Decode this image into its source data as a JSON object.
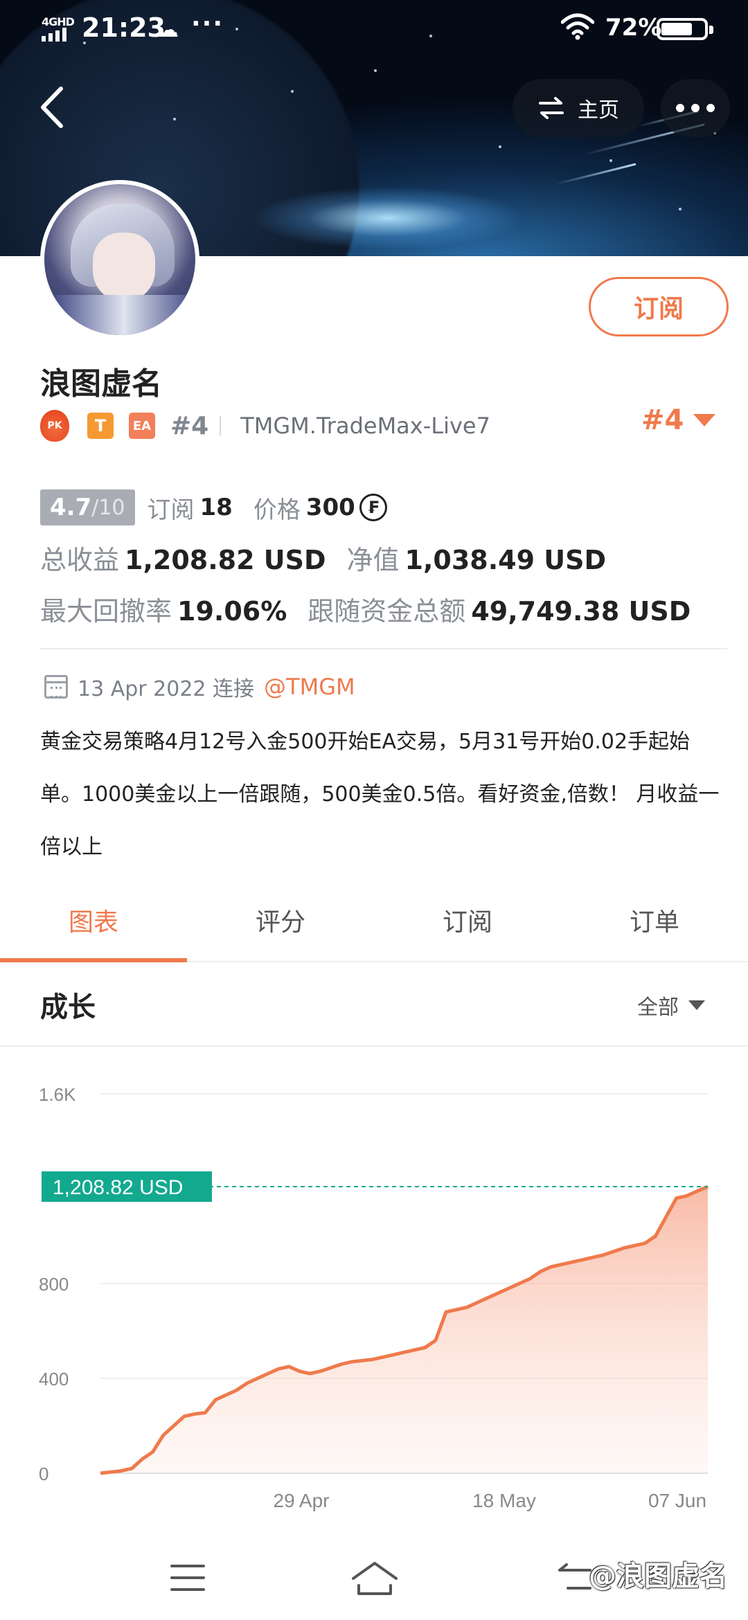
{
  "status_bar": {
    "network": "4GHD",
    "time": "21:23",
    "dots": "···",
    "battery_percent": "72%",
    "battery_level": 0.72
  },
  "header": {
    "home_label": "主页"
  },
  "profile": {
    "name": "浪图虚名",
    "subscribe_label": "订阅",
    "badge_pk": "PK",
    "badge_t": "T",
    "badge_ea": "EA",
    "rank": "#4",
    "broker": "TMGM.TradeMax-Live7",
    "rank_selector": "#4"
  },
  "stats": {
    "score": "4.7",
    "score_max": "/10",
    "subscribe_label": "订阅",
    "subscribe_count": "18",
    "price_label": "价格",
    "price_value": "300",
    "coin_symbol": "₣",
    "total_profit_label": "总收益",
    "total_profit_value": "1,208.82 USD",
    "net_value_label": "净值",
    "net_value_value": "1,038.49 USD",
    "max_drawdown_label": "最大回撤率",
    "max_drawdown_value": "19.06%",
    "follow_funds_label": "跟随资金总额",
    "follow_funds_value": "49,749.38 USD"
  },
  "connection": {
    "date": "13 Apr 2022 连接",
    "mention": "@TMGM"
  },
  "description": "黄金交易策略4月12号入金500开始EA交易，5月31号开始0.02手起始单。1000美金以上一倍跟随，500美金0.5倍。看好资金,倍数！ 月收益一倍以上",
  "tabs": [
    {
      "label": "图表",
      "active": true
    },
    {
      "label": "评分",
      "active": false
    },
    {
      "label": "订阅",
      "active": false
    },
    {
      "label": "订单",
      "active": false
    }
  ],
  "growth": {
    "title": "成长",
    "range": "全部"
  },
  "chart_data": {
    "type": "area",
    "y_ticks": [
      "0",
      "400",
      "800",
      "1.6K"
    ],
    "y_tick_values": [
      0,
      400,
      800,
      1600
    ],
    "ylim": [
      0,
      1600
    ],
    "x_ticks": [
      "29 Apr",
      "18 May",
      "07 Jun"
    ],
    "current_label": "1,208.82 USD",
    "current_value": 1208.82,
    "color": "#ef7a4c",
    "marker_color": "#13a98f",
    "values": [
      0,
      5,
      10,
      20,
      60,
      90,
      160,
      200,
      240,
      250,
      255,
      310,
      330,
      350,
      380,
      400,
      420,
      440,
      450,
      430,
      420,
      430,
      445,
      460,
      470,
      475,
      480,
      490,
      500,
      510,
      520,
      530,
      560,
      680,
      690,
      700,
      720,
      740,
      760,
      780,
      800,
      820,
      850,
      870,
      880,
      890,
      900,
      910,
      920,
      935,
      950,
      960,
      970,
      1000,
      1080,
      1160,
      1170,
      1190,
      1208.82
    ]
  },
  "nav": {
    "watermark": "@浪图虚名"
  }
}
